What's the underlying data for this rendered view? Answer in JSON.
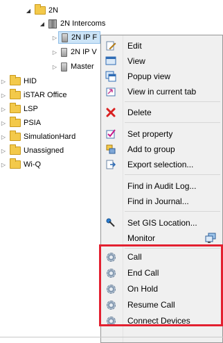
{
  "tree": {
    "items": [
      {
        "label": "2N",
        "kind": "folder",
        "state": "open"
      },
      {
        "label": "2N Intercoms",
        "kind": "group",
        "state": "open"
      },
      {
        "label": "2N IP F",
        "kind": "device",
        "state": "closed"
      },
      {
        "label": "2N IP V",
        "kind": "device",
        "state": "closed"
      },
      {
        "label": "Master",
        "kind": "device",
        "state": "closed"
      },
      {
        "label": "HID",
        "kind": "folder",
        "state": "closed"
      },
      {
        "label": "iSTAR Office",
        "kind": "folder",
        "state": "closed"
      },
      {
        "label": "LSP",
        "kind": "folder",
        "state": "closed"
      },
      {
        "label": "PSIA",
        "kind": "folder",
        "state": "closed"
      },
      {
        "label": "SimulationHard",
        "kind": "folder",
        "state": "closed"
      },
      {
        "label": "Unassigned",
        "kind": "folder",
        "state": "closed"
      },
      {
        "label": "Wi-Q",
        "kind": "folder",
        "state": "closed"
      }
    ]
  },
  "context_menu": {
    "items": [
      {
        "label": "Edit",
        "icon": "edit-icon"
      },
      {
        "label": "View",
        "icon": "view-icon"
      },
      {
        "label": "Popup view",
        "icon": "popup-view-icon"
      },
      {
        "label": "View in current tab",
        "icon": "view-tab-icon"
      },
      {
        "label": "Delete",
        "icon": "delete-icon"
      },
      {
        "label": "Set property",
        "icon": "set-property-icon"
      },
      {
        "label": "Add to group",
        "icon": "add-group-icon"
      },
      {
        "label": "Export selection...",
        "icon": "export-icon"
      },
      {
        "label": "Find in Audit Log...",
        "icon": ""
      },
      {
        "label": "Find in Journal...",
        "icon": ""
      },
      {
        "label": "Set GIS Location...",
        "icon": "gis-pin-icon"
      },
      {
        "label": "Monitor",
        "icon": "monitor-icon"
      },
      {
        "label": "Call",
        "icon": "gear-icon"
      },
      {
        "label": "End Call",
        "icon": "gear-icon"
      },
      {
        "label": "On Hold",
        "icon": "gear-icon"
      },
      {
        "label": "Resume Call",
        "icon": "gear-icon"
      },
      {
        "label": "Connect Devices",
        "icon": "gear-icon"
      }
    ]
  },
  "colors": {
    "highlight_border": "#e32030",
    "menu_background": "#f0f0f0",
    "selection": "#cce4f7",
    "folder": "#f3c94a"
  }
}
